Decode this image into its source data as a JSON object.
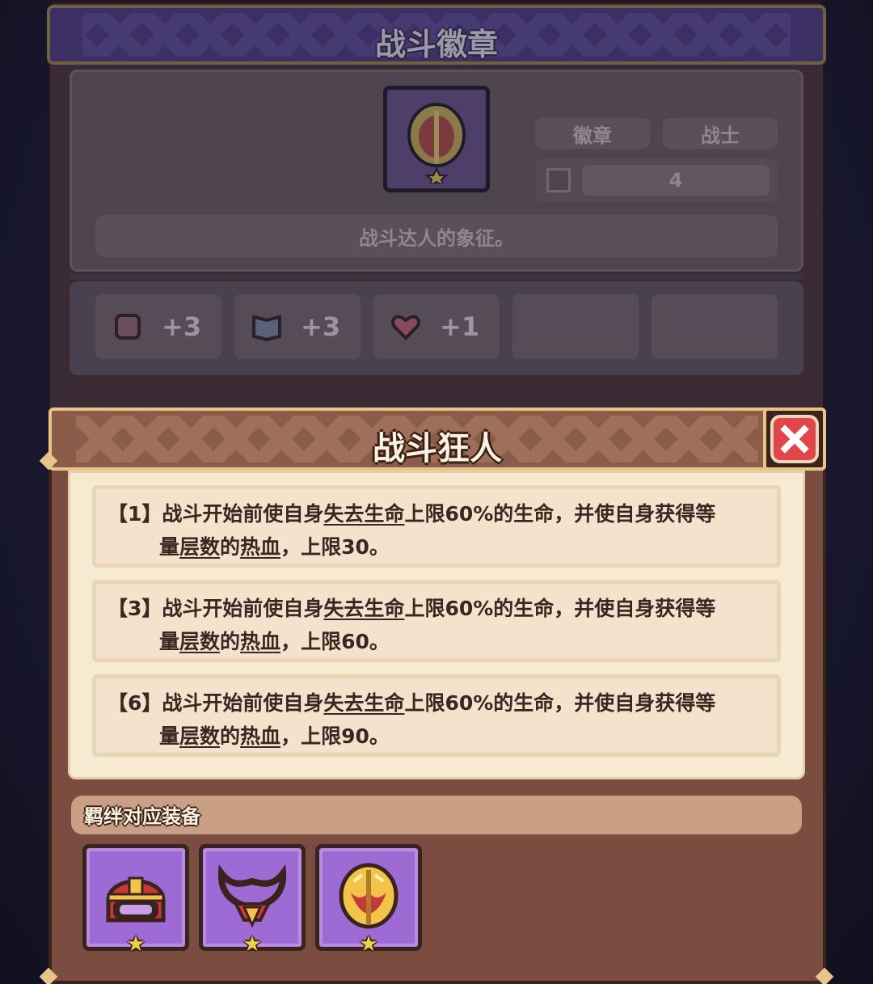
{
  "background_panel": {
    "title": "战斗徽章",
    "tags": [
      "徽章",
      "战士"
    ],
    "stack_value": "4",
    "description": "战斗达人的象征。",
    "stats": [
      {
        "icon": "fist-icon",
        "value": "+3"
      },
      {
        "icon": "book-icon",
        "value": "+3"
      },
      {
        "icon": "heart-icon",
        "value": "+1"
      }
    ]
  },
  "modal": {
    "title": "战斗狂人",
    "effects": [
      {
        "tier": "【1】",
        "pre": "战斗开始前使自身",
        "kw1": "失去生命",
        "mid": "上限60%的生命，并使自身获得等",
        "line2_pre": "量",
        "kw2": "层数",
        "line2_mid": "的",
        "kw3": "热血",
        "line2_post": "，上限30。"
      },
      {
        "tier": "【3】",
        "pre": "战斗开始前使自身",
        "kw1": "失去生命",
        "mid": "上限60%的生命，并使自身获得等",
        "line2_pre": "量",
        "kw2": "层数",
        "line2_mid": "的",
        "kw3": "热血",
        "line2_post": "，上限60。"
      },
      {
        "tier": "【6】",
        "pre": "战斗开始前使自身",
        "kw1": "失去生命",
        "mid": "上限60%的生命，并使自身获得等",
        "line2_pre": "量",
        "kw2": "层数",
        "line2_mid": "的",
        "kw3": "热血",
        "line2_post": "，上限90。"
      }
    ],
    "bond_label": "羁绊对应装备",
    "equipment": [
      {
        "icon": "helmet-icon",
        "stars": "★"
      },
      {
        "icon": "necklace-icon",
        "stars": "★"
      },
      {
        "icon": "badge-icon",
        "stars": "★"
      }
    ]
  },
  "colors": {
    "accent_gold": "#e8c48a",
    "close_red": "#e0464a",
    "slot_purple": "#9e6ad4"
  }
}
